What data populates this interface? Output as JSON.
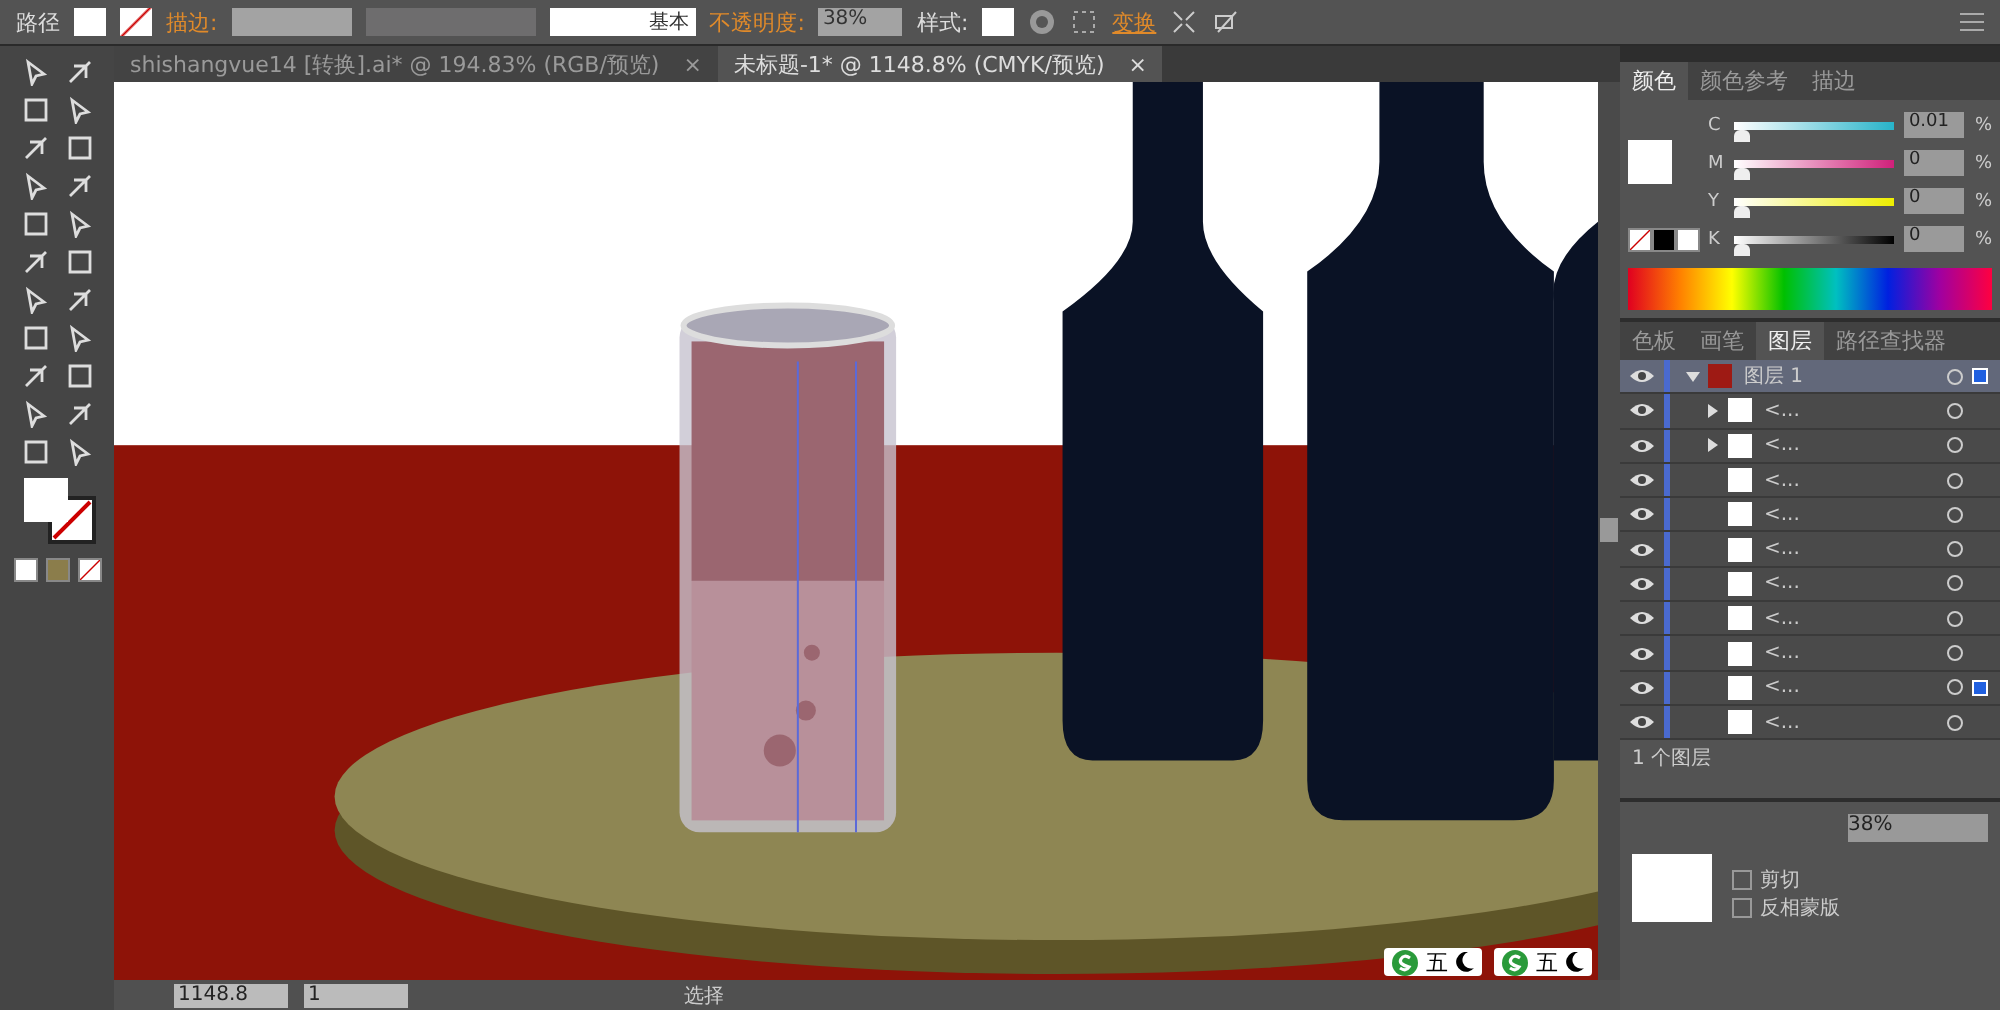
{
  "control_bar": {
    "object_type": "路径",
    "stroke_label": "描边:",
    "stroke_profile": "基本",
    "opacity_label": "不透明度:",
    "opacity": "38%",
    "style_label": "样式:",
    "transform_link": "变换"
  },
  "tabs": [
    {
      "label": "shishangvue14  [转换].ai* @ 194.83% (RGB/预览)",
      "close": "×",
      "selected": false
    },
    {
      "label": "未标题-1* @ 1148.8% (CMYK/预览)",
      "close": "×",
      "selected": true
    }
  ],
  "color_panel": {
    "tabs": [
      {
        "label": "颜色",
        "selected": true
      },
      {
        "label": "颜色参考",
        "selected": false
      },
      {
        "label": "描边",
        "selected": false
      }
    ],
    "channels": [
      {
        "name": "C",
        "value": "0.01",
        "unit": "%",
        "level": 0.0
      },
      {
        "name": "M",
        "value": "0",
        "unit": "%",
        "level": 0.0
      },
      {
        "name": "Y",
        "value": "0",
        "unit": "%",
        "level": 0.0
      },
      {
        "name": "K",
        "value": "0",
        "unit": "%",
        "level": 0.0
      }
    ]
  },
  "layers_panel": {
    "tabs": [
      {
        "label": "色板",
        "selected": false
      },
      {
        "label": "画笔",
        "selected": false
      },
      {
        "label": "图层",
        "selected": true
      },
      {
        "label": "路径查找器",
        "selected": false
      }
    ],
    "layers": [
      {
        "name": "图层 1",
        "expanded": true,
        "selected": true,
        "children": [
          {
            "name": "<...",
            "expandable": true,
            "selected": false
          },
          {
            "name": "<...",
            "expandable": true,
            "selected": false
          },
          {
            "name": "<...",
            "expandable": false,
            "selected": false
          },
          {
            "name": "<...",
            "expandable": false,
            "selected": false
          },
          {
            "name": "<...",
            "expandable": false,
            "selected": false
          },
          {
            "name": "<...",
            "expandable": false,
            "selected": false
          },
          {
            "name": "<...",
            "expandable": false,
            "selected": false
          },
          {
            "name": "<...",
            "expandable": false,
            "selected": false
          },
          {
            "name": "<...",
            "expandable": false,
            "selected": true
          },
          {
            "name": "<...",
            "expandable": false,
            "selected": false
          }
        ]
      }
    ],
    "footer": "1 个图层"
  },
  "transparency_panel": {
    "opacity": "38%",
    "options": [
      {
        "label": "剪切",
        "checked": false
      },
      {
        "label": "反相蒙版",
        "checked": false
      }
    ]
  },
  "status_bar": {
    "zoom": "1148.8",
    "page": "1",
    "tool": "选择"
  },
  "ime_bars": [
    {
      "label": "五"
    },
    {
      "label": "五"
    }
  ]
}
